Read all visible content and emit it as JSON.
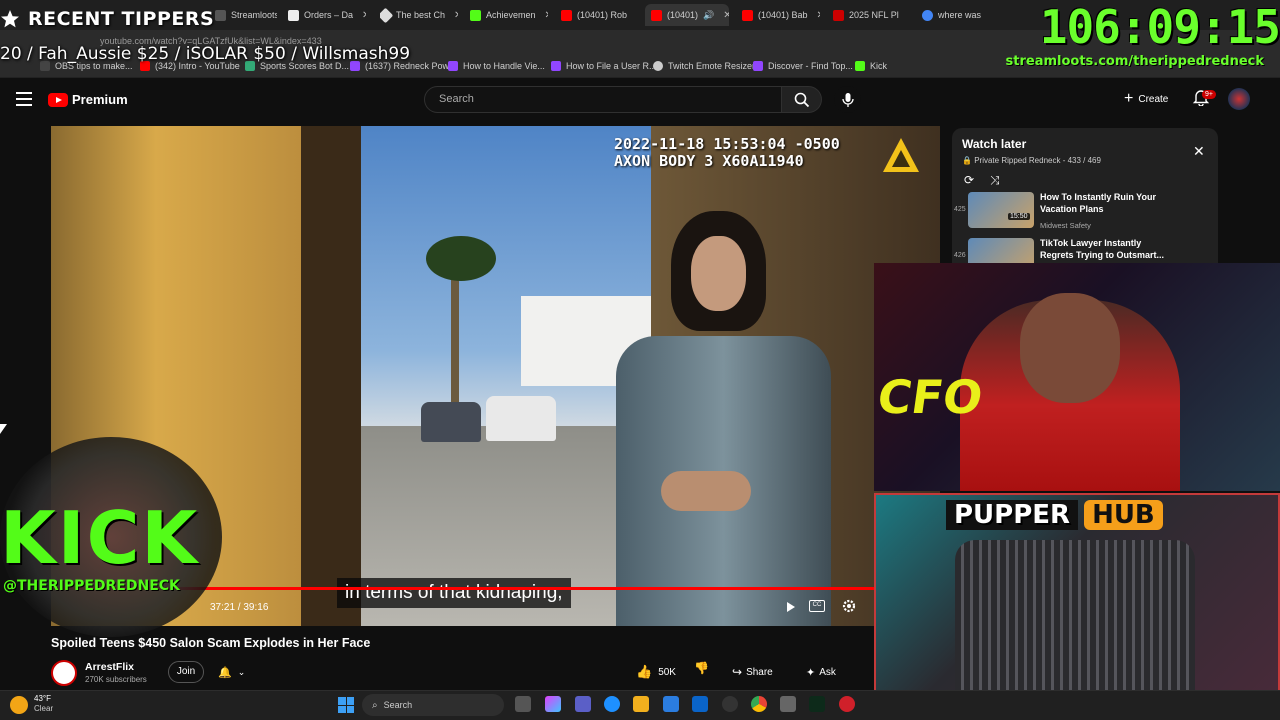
{
  "browser": {
    "tabs": [
      {
        "label": "Streamloots",
        "active": false
      },
      {
        "label": "Orders – Da",
        "active": false
      },
      {
        "label": "The best Ch",
        "active": false
      },
      {
        "label": "Achievemen",
        "active": false
      },
      {
        "label": "(10401) Rob",
        "active": false
      },
      {
        "label": "(10401)",
        "active": true
      },
      {
        "label": "(10401) Bab",
        "active": false
      },
      {
        "label": "2025 NFL Pl",
        "active": false
      },
      {
        "label": "where was",
        "active": false
      }
    ],
    "url": "youtube.com/watch?v=qLGATzfUk&list=WL&index=433",
    "bookmarks": [
      "OBS tips to make...",
      "(342) Intro - YouTube",
      "Sports Scores Bot D...",
      "(1637) Redneck Pow...",
      "How to Handle Vie...",
      "How to File a User R...",
      "Twitch Emote Resizer",
      "Discover - Find Top...",
      "Kick"
    ]
  },
  "overlay": {
    "recent_tippers_label": "RECENT TIPPERS",
    "ticker": "20 / Fah_Aussie $25 / iSOLAR $50 / Willsmash99",
    "timer": "106:09:15",
    "streamloots_url": "streamloots.com/therippedredneck",
    "kick_logo": "KICK",
    "kick_handle": "@THERIPPEDREDNECK",
    "webcam_sign": "CFO",
    "pupper_word": "PUPPER",
    "hub_word": "HUB"
  },
  "youtube": {
    "brand": "Premium",
    "search_placeholder": "Search",
    "create_label": "Create",
    "notif_count": "9+",
    "video": {
      "timestamp_line1": "2022-11-18 15:53:04 -0500",
      "timestamp_line2": "AXON BODY 3 X60A11940",
      "subtitle": "in terms of that kidnaping,",
      "time": "37:21 / 39:16",
      "progress": 0.951
    },
    "title": "Spoiled Teens $450 Salon Scam Explodes in Her Face",
    "channel": {
      "name": "ArrestFlix",
      "subs": "270K subscribers",
      "join_label": "Join"
    },
    "actions": {
      "likes": "50K",
      "share": "Share",
      "ask": "Ask"
    },
    "watch_later": {
      "title": "Watch later",
      "subtitle": "Private Ripped Redneck - 433 / 469",
      "items": [
        {
          "index": "425",
          "title": "How To Instantly Ruin Your Vacation Plans",
          "channel": "Midwest Safety",
          "duration": "15:50"
        },
        {
          "index": "426",
          "title": "TikTok Lawyer Instantly Regrets Trying to Outsmart...",
          "channel": "",
          "duration": "24:16"
        }
      ]
    }
  },
  "taskbar": {
    "weather_temp": "43°F",
    "weather_desc": "Clear",
    "search_label": "Search"
  },
  "colors": {
    "accent_green": "#53fc18",
    "timer_green": "#6aff2c",
    "yt_red": "#ff0000",
    "pupper_orange": "#f59f1a"
  }
}
